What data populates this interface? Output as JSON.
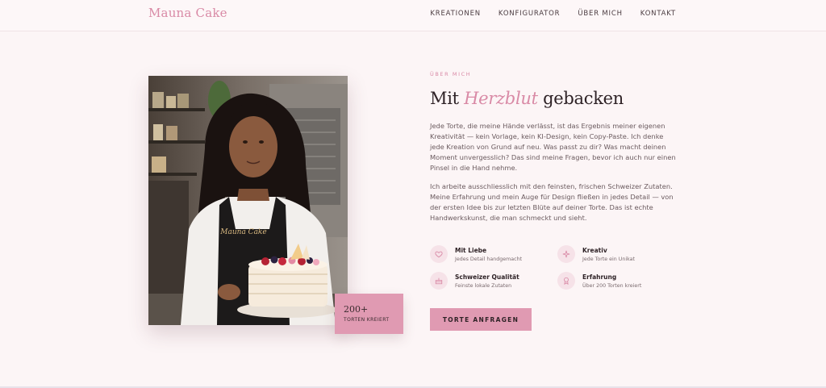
{
  "nav": {
    "brand": "Mauna Cake",
    "links": [
      "KREATIONEN",
      "KONFIGURATOR",
      "ÜBER MICH",
      "KONTAKT"
    ]
  },
  "hero": {
    "photo_apron_text": "Mauna Cake",
    "badge_number": "200+",
    "badge_label": "TORTEN KREIERT"
  },
  "about": {
    "eyebrow": "ÜBER MICH",
    "headline_pre": "Mit",
    "headline_accent": "Herzblut",
    "headline_post": "gebacken",
    "paragraph1": "Jede Torte, die meine Hände verlässt, ist das Ergebnis meiner eigenen Kreativität — kein Vorlage, kein KI-Design, kein Copy-Paste. Ich denke jede Kreation von Grund auf neu. Was passt zu dir? Was macht deinen Moment unvergesslich? Das sind meine Fragen, bevor ich auch nur einen Pinsel in die Hand nehme.",
    "paragraph2": "Ich arbeite ausschliesslich mit den feinsten, frischen Schweizer Zutaten. Meine Erfahrung und mein Auge für Design fließen in jedes Detail — von der ersten Idee bis zur letzten Blüte auf deiner Torte. Das ist echte Handwerkskunst, die man schmeckt und sieht."
  },
  "features": [
    {
      "icon": "heart-icon",
      "title": "Mit Liebe",
      "desc": "Jedes Detail handgemacht"
    },
    {
      "icon": "sparkle-icon",
      "title": "Kreativ",
      "desc": "Jede Torte ein Unikat"
    },
    {
      "icon": "cake-icon",
      "title": "Schweizer Qualität",
      "desc": "Feinste lokale Zutaten"
    },
    {
      "icon": "award-icon",
      "title": "Erfahrung",
      "desc": "Über 200 Torten kreiert"
    }
  ],
  "cta": {
    "label": "TORTE ANFRAGEN"
  },
  "colors": {
    "accent": "#e09ab2",
    "brand": "#d98aa6",
    "background": "#fcf5f6"
  }
}
